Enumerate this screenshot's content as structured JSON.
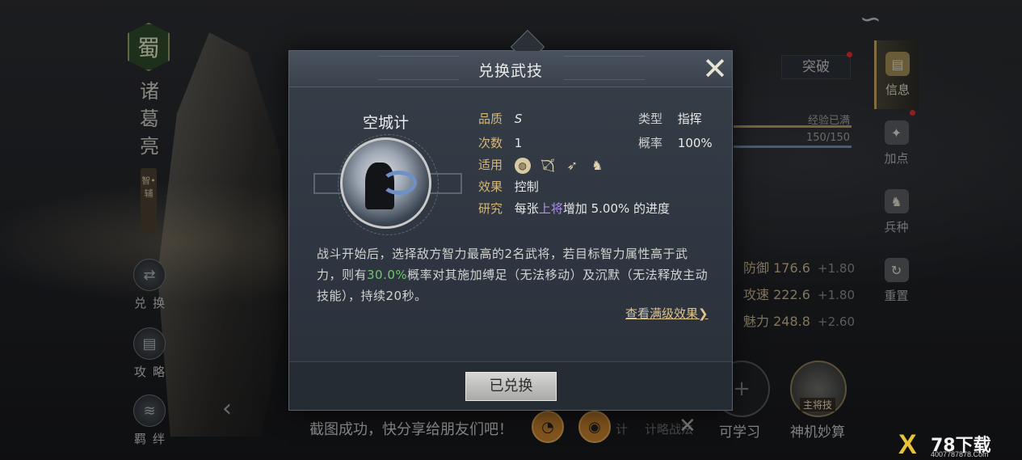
{
  "hero": {
    "faction": "蜀",
    "name_chars": [
      "诸",
      "葛",
      "亮"
    ],
    "role": "智•辅"
  },
  "left_menu": [
    {
      "label": "兑换",
      "icon": "exchange-icon"
    },
    {
      "label": "攻略",
      "icon": "scroll-icon"
    },
    {
      "label": "羁绊",
      "icon": "bond-icon"
    }
  ],
  "right_menu": [
    {
      "label": "信息",
      "icon": "scroll-icon",
      "active": true
    },
    {
      "label": "加点",
      "icon": "points-icon",
      "active": false
    },
    {
      "label": "兵种",
      "icon": "troop-icon",
      "active": false
    },
    {
      "label": "重置",
      "icon": "reset-icon",
      "active": false
    }
  ],
  "panel": {
    "breakthrough": "突破",
    "exp_label": "经验已满",
    "exp_value": "150/150",
    "stats": [
      {
        "label": "防御",
        "value": "176.6",
        "bonus": "+1.80"
      },
      {
        "label": "攻速",
        "value": "222.6",
        "bonus": "+1.80"
      },
      {
        "label": "魅力",
        "value": "248.8",
        "bonus": "+2.60"
      }
    ],
    "slot_plus": "+",
    "slot_plus_label": "可学习",
    "slot_skill_badge": "主将技",
    "slot_skill_label": "神机妙算"
  },
  "share": {
    "text": "截图成功，快分享给朋友们吧！",
    "ghost_1": "计",
    "ghost_2": "计略战法",
    "close": "✕"
  },
  "modal": {
    "title": "兑换武技",
    "skill_name": "空城计",
    "quality_label": "品质",
    "quality_value": "S",
    "type_label": "类型",
    "type_value": "指挥",
    "count_label": "次数",
    "count_value": "1",
    "rate_label": "概率",
    "rate_value": "100%",
    "applicable_label": "适用",
    "applicable_icons": [
      "shield-icon",
      "bow-icon",
      "spear-icon",
      "horse-icon"
    ],
    "effect_label": "效果",
    "effect_value": "控制",
    "research_label": "研究",
    "research_pre": "每张",
    "research_hl": "上将",
    "research_post": "增加 5.00% 的进度",
    "desc_part1": "战斗开始后，选择敌方智力最高的2名武将，若目标智力属性高于武力，则有",
    "desc_hl": "30.0%",
    "desc_part2": "概率对其施加缚足（无法移动）及沉默（无法释放主动技能），持续20秒。",
    "more_link": "查看满级效果❯",
    "button": "已兑换"
  },
  "watermark": {
    "logo": "X",
    "title": "78下载",
    "url": "4007787878.Com"
  },
  "colors": {
    "gold": "#d5b778",
    "green_highlight": "#6cc86a",
    "purple_highlight": "#b38ef2",
    "red_dot": "#d93232"
  }
}
